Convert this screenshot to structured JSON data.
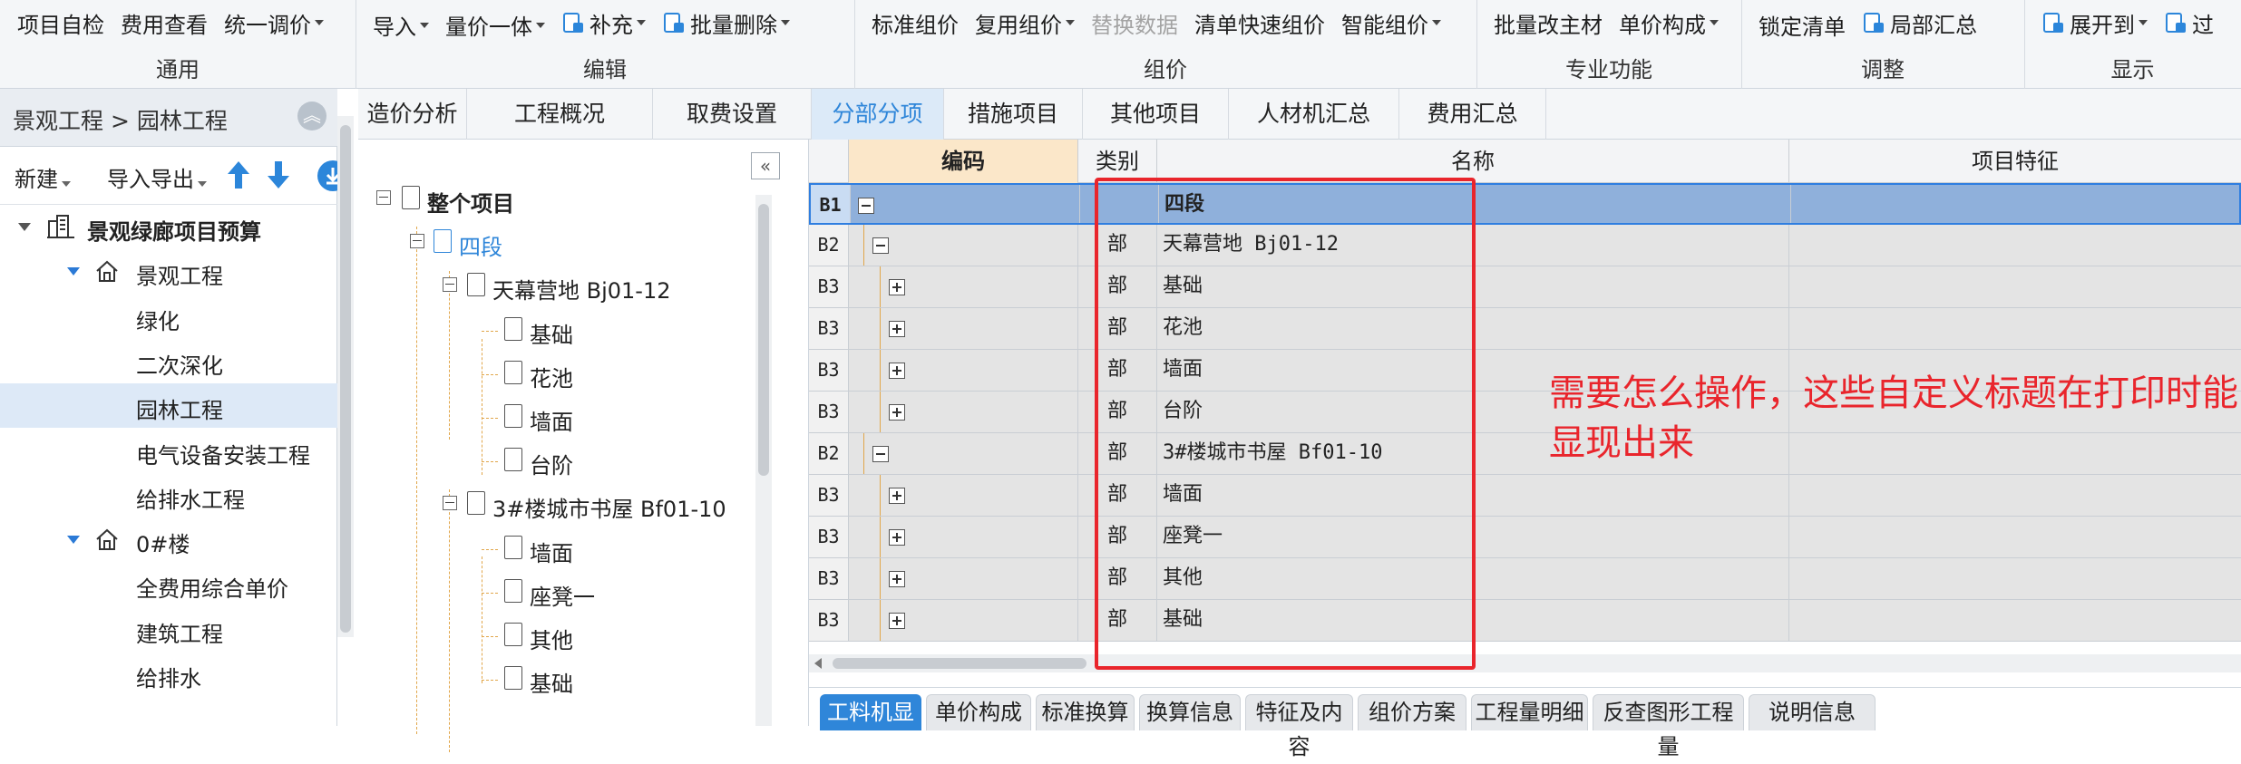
{
  "ribbon": {
    "groups": [
      {
        "label": "通用",
        "items": [
          {
            "text": "项目自检"
          },
          {
            "text": "费用查看"
          },
          {
            "text": "统一调价",
            "dropdown": true
          }
        ]
      },
      {
        "label": "编辑",
        "items": [
          {
            "text": "导入",
            "dropdown": true
          },
          {
            "text": "量价一体",
            "dropdown": true
          },
          {
            "text": "补充",
            "dropdown": true,
            "icon": "supplement-icon"
          },
          {
            "text": "批量删除",
            "dropdown": true,
            "icon": "batch-delete-icon"
          }
        ]
      },
      {
        "label": "组价",
        "items": [
          {
            "text": "标准组价"
          },
          {
            "text": "复用组价",
            "dropdown": true
          },
          {
            "text": "替换数据",
            "disabled": true
          },
          {
            "text": "清单快速组价"
          },
          {
            "text": "智能组价",
            "dropdown": true
          }
        ]
      },
      {
        "label": "专业功能",
        "items": [
          {
            "text": "批量改主材"
          },
          {
            "text": "单价构成",
            "dropdown": true
          }
        ]
      },
      {
        "label": "调整",
        "items": [
          {
            "text": "锁定清单"
          },
          {
            "text": "局部汇总",
            "icon": "summary-icon"
          }
        ]
      },
      {
        "label": "显示",
        "items": [
          {
            "text": "展开到",
            "dropdown": true,
            "icon": "expand-icon"
          },
          {
            "text": "过",
            "icon": "filter-icon"
          }
        ]
      }
    ]
  },
  "left_panel": {
    "breadcrumb": "景观工程 > 园林工程",
    "toolbar": {
      "new_label": "新建",
      "import_export_label": "导入导出"
    },
    "tree": [
      {
        "label": "景观绿廊项目预算",
        "level": 0,
        "icon": "building-icon"
      },
      {
        "label": "景观工程",
        "level": 1,
        "icon": "home-icon"
      },
      {
        "label": "绿化",
        "level": 2
      },
      {
        "label": "二次深化",
        "level": 2
      },
      {
        "label": "园林工程",
        "level": 2,
        "selected": true
      },
      {
        "label": "电气设备安装工程",
        "level": 2
      },
      {
        "label": "给排水工程",
        "level": 2
      },
      {
        "label": "0#楼",
        "level": 1,
        "icon": "home-icon"
      },
      {
        "label": "全费用综合单价",
        "level": 2
      },
      {
        "label": "建筑工程",
        "level": 2
      },
      {
        "label": "给排水",
        "level": 2
      }
    ]
  },
  "tabs": [
    {
      "label": "造价分析"
    },
    {
      "label": "工程概况"
    },
    {
      "label": "取费设置"
    },
    {
      "label": "分部分项",
      "active": true
    },
    {
      "label": "措施项目"
    },
    {
      "label": "其他项目"
    },
    {
      "label": "人材机汇总"
    },
    {
      "label": "费用汇总"
    }
  ],
  "mid_tree": [
    {
      "label": "整个项目",
      "level": 0
    },
    {
      "label": "四段",
      "level": 1
    },
    {
      "label": "天幕营地 Bj01-12",
      "level": 2
    },
    {
      "label": "基础",
      "level": 3
    },
    {
      "label": "花池",
      "level": 3
    },
    {
      "label": "墙面",
      "level": 3
    },
    {
      "label": "台阶",
      "level": 3
    },
    {
      "label": "3#楼城市书屋 Bf01-10",
      "level": 2
    },
    {
      "label": "墙面",
      "level": 3
    },
    {
      "label": "座凳一",
      "level": 3
    },
    {
      "label": "其他",
      "level": 3
    },
    {
      "label": "基础",
      "level": 3
    }
  ],
  "grid": {
    "headers": {
      "code": "编码",
      "type": "类别",
      "name": "名称",
      "feature": "项目特征"
    },
    "rows": [
      {
        "lvl": "B1",
        "type": "",
        "name": "四段",
        "box": "minus",
        "indent": 0,
        "selected": true
      },
      {
        "lvl": "B2",
        "type": "部",
        "name": "天幕营地 Bj01-12",
        "box": "minus",
        "indent": 1
      },
      {
        "lvl": "B3",
        "type": "部",
        "name": "基础",
        "box": "plus",
        "indent": 2
      },
      {
        "lvl": "B3",
        "type": "部",
        "name": "花池",
        "box": "plus",
        "indent": 2
      },
      {
        "lvl": "B3",
        "type": "部",
        "name": "墙面",
        "box": "plus",
        "indent": 2
      },
      {
        "lvl": "B3",
        "type": "部",
        "name": "台阶",
        "box": "plus",
        "indent": 2
      },
      {
        "lvl": "B2",
        "type": "部",
        "name": "3#楼城市书屋 Bf01-10",
        "box": "minus",
        "indent": 1
      },
      {
        "lvl": "B3",
        "type": "部",
        "name": "墙面",
        "box": "plus",
        "indent": 2
      },
      {
        "lvl": "B3",
        "type": "部",
        "name": "座凳一",
        "box": "plus",
        "indent": 2
      },
      {
        "lvl": "B3",
        "type": "部",
        "name": "其他",
        "box": "plus",
        "indent": 2
      },
      {
        "lvl": "B3",
        "type": "部",
        "name": "基础",
        "box": "plus",
        "indent": 2
      }
    ]
  },
  "bottom_tabs": [
    {
      "label": "工料机显示",
      "active": true
    },
    {
      "label": "单价构成"
    },
    {
      "label": "标准换算"
    },
    {
      "label": "换算信息"
    },
    {
      "label": "特征及内容"
    },
    {
      "label": "组价方案"
    },
    {
      "label": "工程量明细"
    },
    {
      "label": "反查图形工程量"
    },
    {
      "label": "说明信息"
    }
  ],
  "annotation": {
    "text": "需要怎么操作，这些自定义标题在打印时能显现出来",
    "color": "#e9252c"
  },
  "colors": {
    "accent": "#2f86d9",
    "selection": "#8fb0db",
    "code_header": "#fbe7c9"
  }
}
